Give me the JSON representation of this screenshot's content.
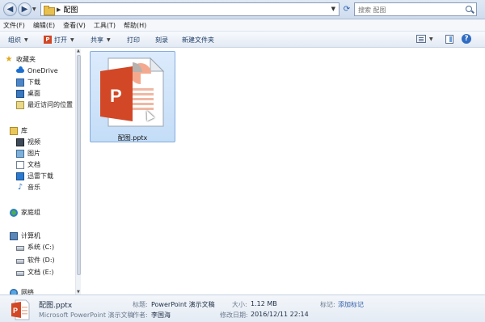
{
  "address_bar": {
    "path": "配图",
    "search_placeholder": "搜索 配图"
  },
  "menu": [
    "文件(F)",
    "编辑(E)",
    "查看(V)",
    "工具(T)",
    "帮助(H)"
  ],
  "toolbar": {
    "organize": "组织",
    "open": "打开",
    "share": "共享",
    "print": "打印",
    "burn": "刻录",
    "new_folder": "新建文件夹"
  },
  "nav": {
    "favorites": "收藏夹",
    "onedrive": "OneDrive",
    "downloads": "下载",
    "desktop": "桌面",
    "recent": "最近访问的位置",
    "libraries": "库",
    "videos": "视频",
    "pictures": "图片",
    "documents": "文档",
    "thunder": "迅雷下载",
    "music": "音乐",
    "homegroup": "家庭组",
    "computer": "计算机",
    "drive_c": "系统 (C:)",
    "drive_d": "软件 (D:)",
    "drive_e": "文档 (E:)",
    "network": "网络"
  },
  "file": {
    "name": "配图.pptx",
    "icon": "powerpoint-icon",
    "icon_letter": "P"
  },
  "details": {
    "name": "配图.pptx",
    "type": "Microsoft PowerPoint 演示文稿",
    "title_label": "标题:",
    "title_value": "PowerPoint 演示文稿",
    "author_label": "作者:",
    "author_value": "李国海",
    "size_label": "大小:",
    "size_value": "1.12 MB",
    "modified_label": "修改日期:",
    "modified_value": "2016/12/11 22:14",
    "tags_label": "标记:",
    "tags_value": "添加标记"
  },
  "colors": {
    "ppt_orange": "#D24726",
    "selection": "#CCE3F9",
    "accent": "#2D5AA7"
  }
}
